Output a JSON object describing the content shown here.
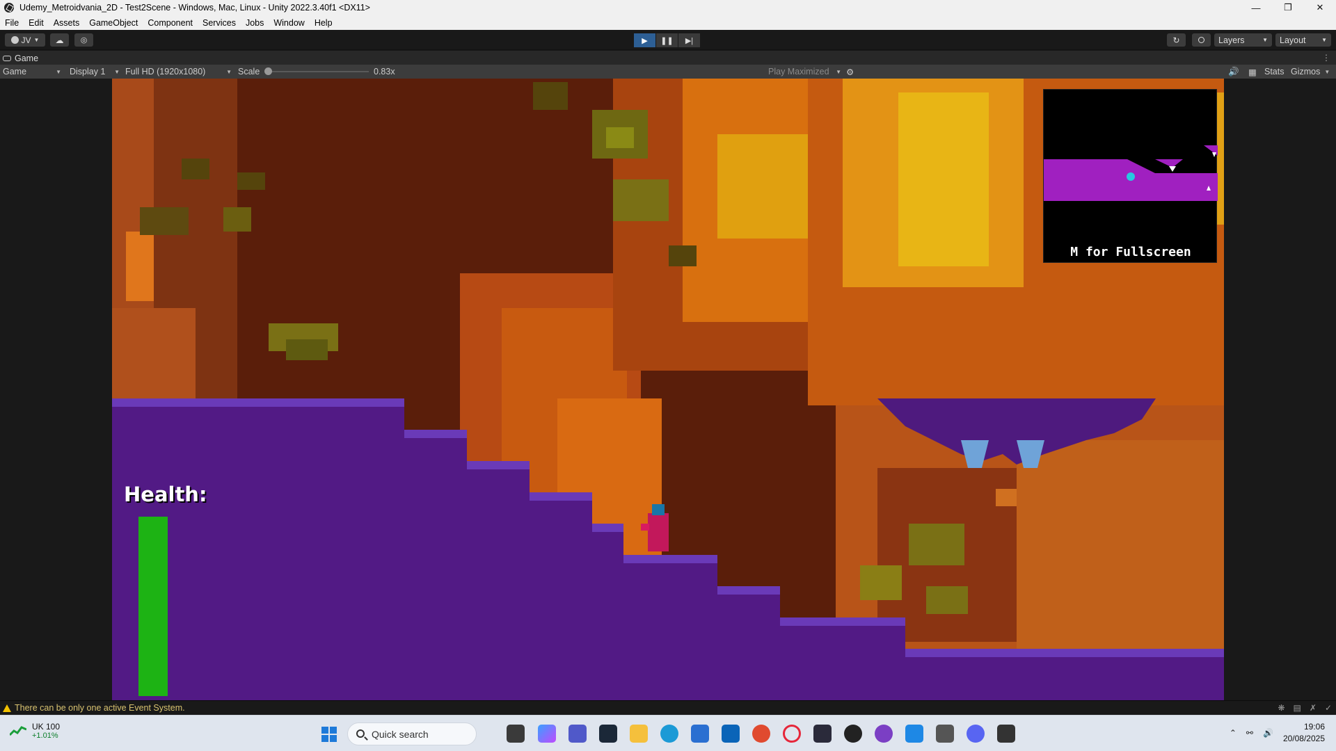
{
  "window": {
    "title": "Udemy_Metroidvania_2D - Test2Scene - Windows, Mac, Linux - Unity 2022.3.40f1 <DX11>"
  },
  "menu": [
    "File",
    "Edit",
    "Assets",
    "GameObject",
    "Component",
    "Services",
    "Jobs",
    "Window",
    "Help"
  ],
  "toolbar": {
    "account_label": "JV",
    "layers_label": "Layers",
    "layout_label": "Layout"
  },
  "game_tab": {
    "label": "Game"
  },
  "game_controls": {
    "view_mode": "Game",
    "display": "Display 1",
    "resolution": "Full HD (1920x1080)",
    "scale_label": "Scale",
    "scale_value": "0.83x",
    "play_mode": "Play Maximized",
    "stats_label": "Stats",
    "gizmos_label": "Gizmos"
  },
  "hud": {
    "minimap_hint": "M for Fullscreen",
    "health_label": "Health:",
    "health_fraction": 1.0
  },
  "status": {
    "message": "There can be only one active Event System."
  },
  "taskbar": {
    "stock_name": "UK 100",
    "stock_change": "+1.01%",
    "search_placeholder": "Quick search",
    "time": "19:06",
    "date": "20/08/2025"
  },
  "colors": {
    "play_active": "#2d5f95",
    "health_green": "#1db314",
    "purple_rock": "#521a85",
    "lava_orange": "#c85a10"
  }
}
